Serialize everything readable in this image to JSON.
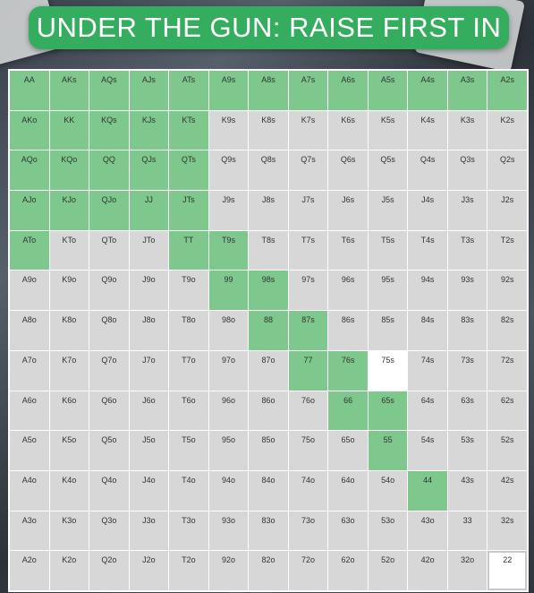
{
  "title": "UNDER THE GUN: RAISE FIRST IN",
  "colors": {
    "title_bg": "#34ad5f",
    "raise": "#7ec88e",
    "fold": "#d7d7d7",
    "highlight": "#ffffff"
  },
  "legend_semantics": {
    "raise": "green cell",
    "fold": "grey cell"
  },
  "grid": [
    [
      "AA",
      "AKs",
      "AQs",
      "AJs",
      "ATs",
      "A9s",
      "A8s",
      "A7s",
      "A6s",
      "A5s",
      "A4s",
      "A3s",
      "A2s"
    ],
    [
      "AKo",
      "KK",
      "KQs",
      "KJs",
      "KTs",
      "K9s",
      "K8s",
      "K7s",
      "K6s",
      "K5s",
      "K4s",
      "K3s",
      "K2s"
    ],
    [
      "AQo",
      "KQo",
      "QQ",
      "QJs",
      "QTs",
      "Q9s",
      "Q8s",
      "Q7s",
      "Q6s",
      "Q5s",
      "Q4s",
      "Q3s",
      "Q2s"
    ],
    [
      "AJo",
      "KJo",
      "QJo",
      "JJ",
      "JTs",
      "J9s",
      "J8s",
      "J7s",
      "J6s",
      "J5s",
      "J4s",
      "J3s",
      "J2s"
    ],
    [
      "ATo",
      "KTo",
      "QTo",
      "JTo",
      "TT",
      "T9s",
      "T8s",
      "T7s",
      "T6s",
      "T5s",
      "T4s",
      "T3s",
      "T2s"
    ],
    [
      "A9o",
      "K9o",
      "Q9o",
      "J9o",
      "T9o",
      "99",
      "98s",
      "97s",
      "96s",
      "95s",
      "94s",
      "93s",
      "92s"
    ],
    [
      "A8o",
      "K8o",
      "Q8o",
      "J8o",
      "T8o",
      "98o",
      "88",
      "87s",
      "86s",
      "85s",
      "84s",
      "83s",
      "82s"
    ],
    [
      "A7o",
      "K7o",
      "Q7o",
      "J7o",
      "T7o",
      "97o",
      "87o",
      "77",
      "76s",
      "75s",
      "74s",
      "73s",
      "72s"
    ],
    [
      "A6o",
      "K6o",
      "Q6o",
      "J6o",
      "T6o",
      "96o",
      "86o",
      "76o",
      "66",
      "65s",
      "64s",
      "63s",
      "62s"
    ],
    [
      "A5o",
      "K5o",
      "Q5o",
      "J5o",
      "T5o",
      "95o",
      "85o",
      "75o",
      "65o",
      "55",
      "54s",
      "53s",
      "52s"
    ],
    [
      "A4o",
      "K4o",
      "Q4o",
      "J4o",
      "T4o",
      "94o",
      "84o",
      "74o",
      "64o",
      "54o",
      "44",
      "43s",
      "42s"
    ],
    [
      "A3o",
      "K3o",
      "Q3o",
      "J3o",
      "T3o",
      "93o",
      "83o",
      "73o",
      "63o",
      "53o",
      "43o",
      "33",
      "32s"
    ],
    [
      "A2o",
      "K2o",
      "Q2o",
      "J2o",
      "T2o",
      "92o",
      "82o",
      "72o",
      "62o",
      "52o",
      "42o",
      "32o",
      "22"
    ]
  ],
  "raise_hands": [
    "AA",
    "AKs",
    "AQs",
    "AJs",
    "ATs",
    "A9s",
    "A8s",
    "A7s",
    "A6s",
    "A5s",
    "A4s",
    "A3s",
    "A2s",
    "AKo",
    "KK",
    "KQs",
    "KJs",
    "KTs",
    "AQo",
    "KQo",
    "QQ",
    "QJs",
    "QTs",
    "AJo",
    "KJo",
    "QJo",
    "JJ",
    "JTs",
    "ATo",
    "TT",
    "T9s",
    "99",
    "98s",
    "88",
    "87s",
    "77",
    "76s",
    "66",
    "65s",
    "55",
    "44"
  ],
  "highlight_hands": [
    "75s"
  ],
  "outlined_hands": [
    "22"
  ]
}
